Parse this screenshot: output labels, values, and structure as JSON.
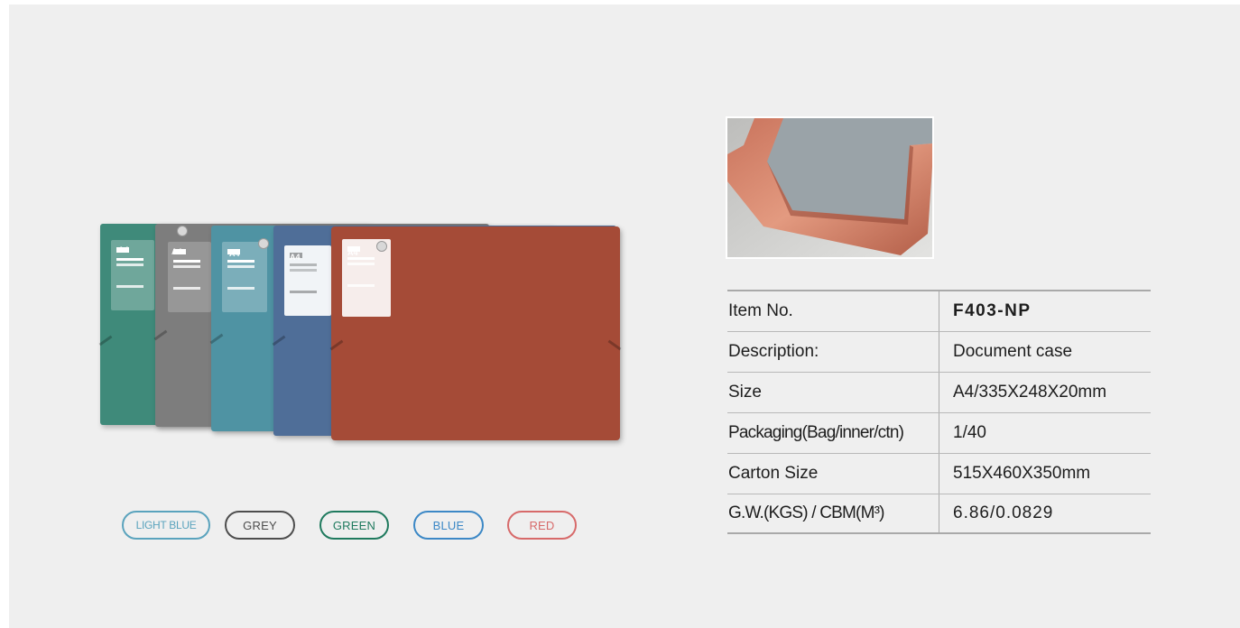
{
  "product_photo": {
    "folders": [
      {
        "color": "#3f8a7a",
        "label": "A4"
      },
      {
        "color": "#7d7d7d",
        "label": "A4"
      },
      {
        "color": "#4f93a3",
        "label": "A4"
      },
      {
        "color": "#4f6e98",
        "label": "A4"
      },
      {
        "color": "#a54b37",
        "label": "A4"
      }
    ]
  },
  "colors": [
    {
      "label": "LIGHT BLUE",
      "color": "#5aa3bd"
    },
    {
      "label": "GREY",
      "color": "#4d4d4d"
    },
    {
      "label": "GREEN",
      "color": "#1f7a5e"
    },
    {
      "label": "BLUE",
      "color": "#3c88c6"
    },
    {
      "label": "RED",
      "color": "#d76a6a"
    }
  ],
  "spec": {
    "rows": [
      {
        "label": "Item No.",
        "value": "F403-NP"
      },
      {
        "label": "Description:",
        "value": "Document case"
      },
      {
        "label": "Size",
        "value": "A4/335X248X20mm"
      },
      {
        "label": "Packaging(Bag/inner/ctn)",
        "value": "1/40"
      },
      {
        "label": "Carton Size",
        "value": "515X460X350mm"
      },
      {
        "label": "G.W.(KGS) / CBM(M³)",
        "value": "6.86/0.0829"
      }
    ]
  }
}
